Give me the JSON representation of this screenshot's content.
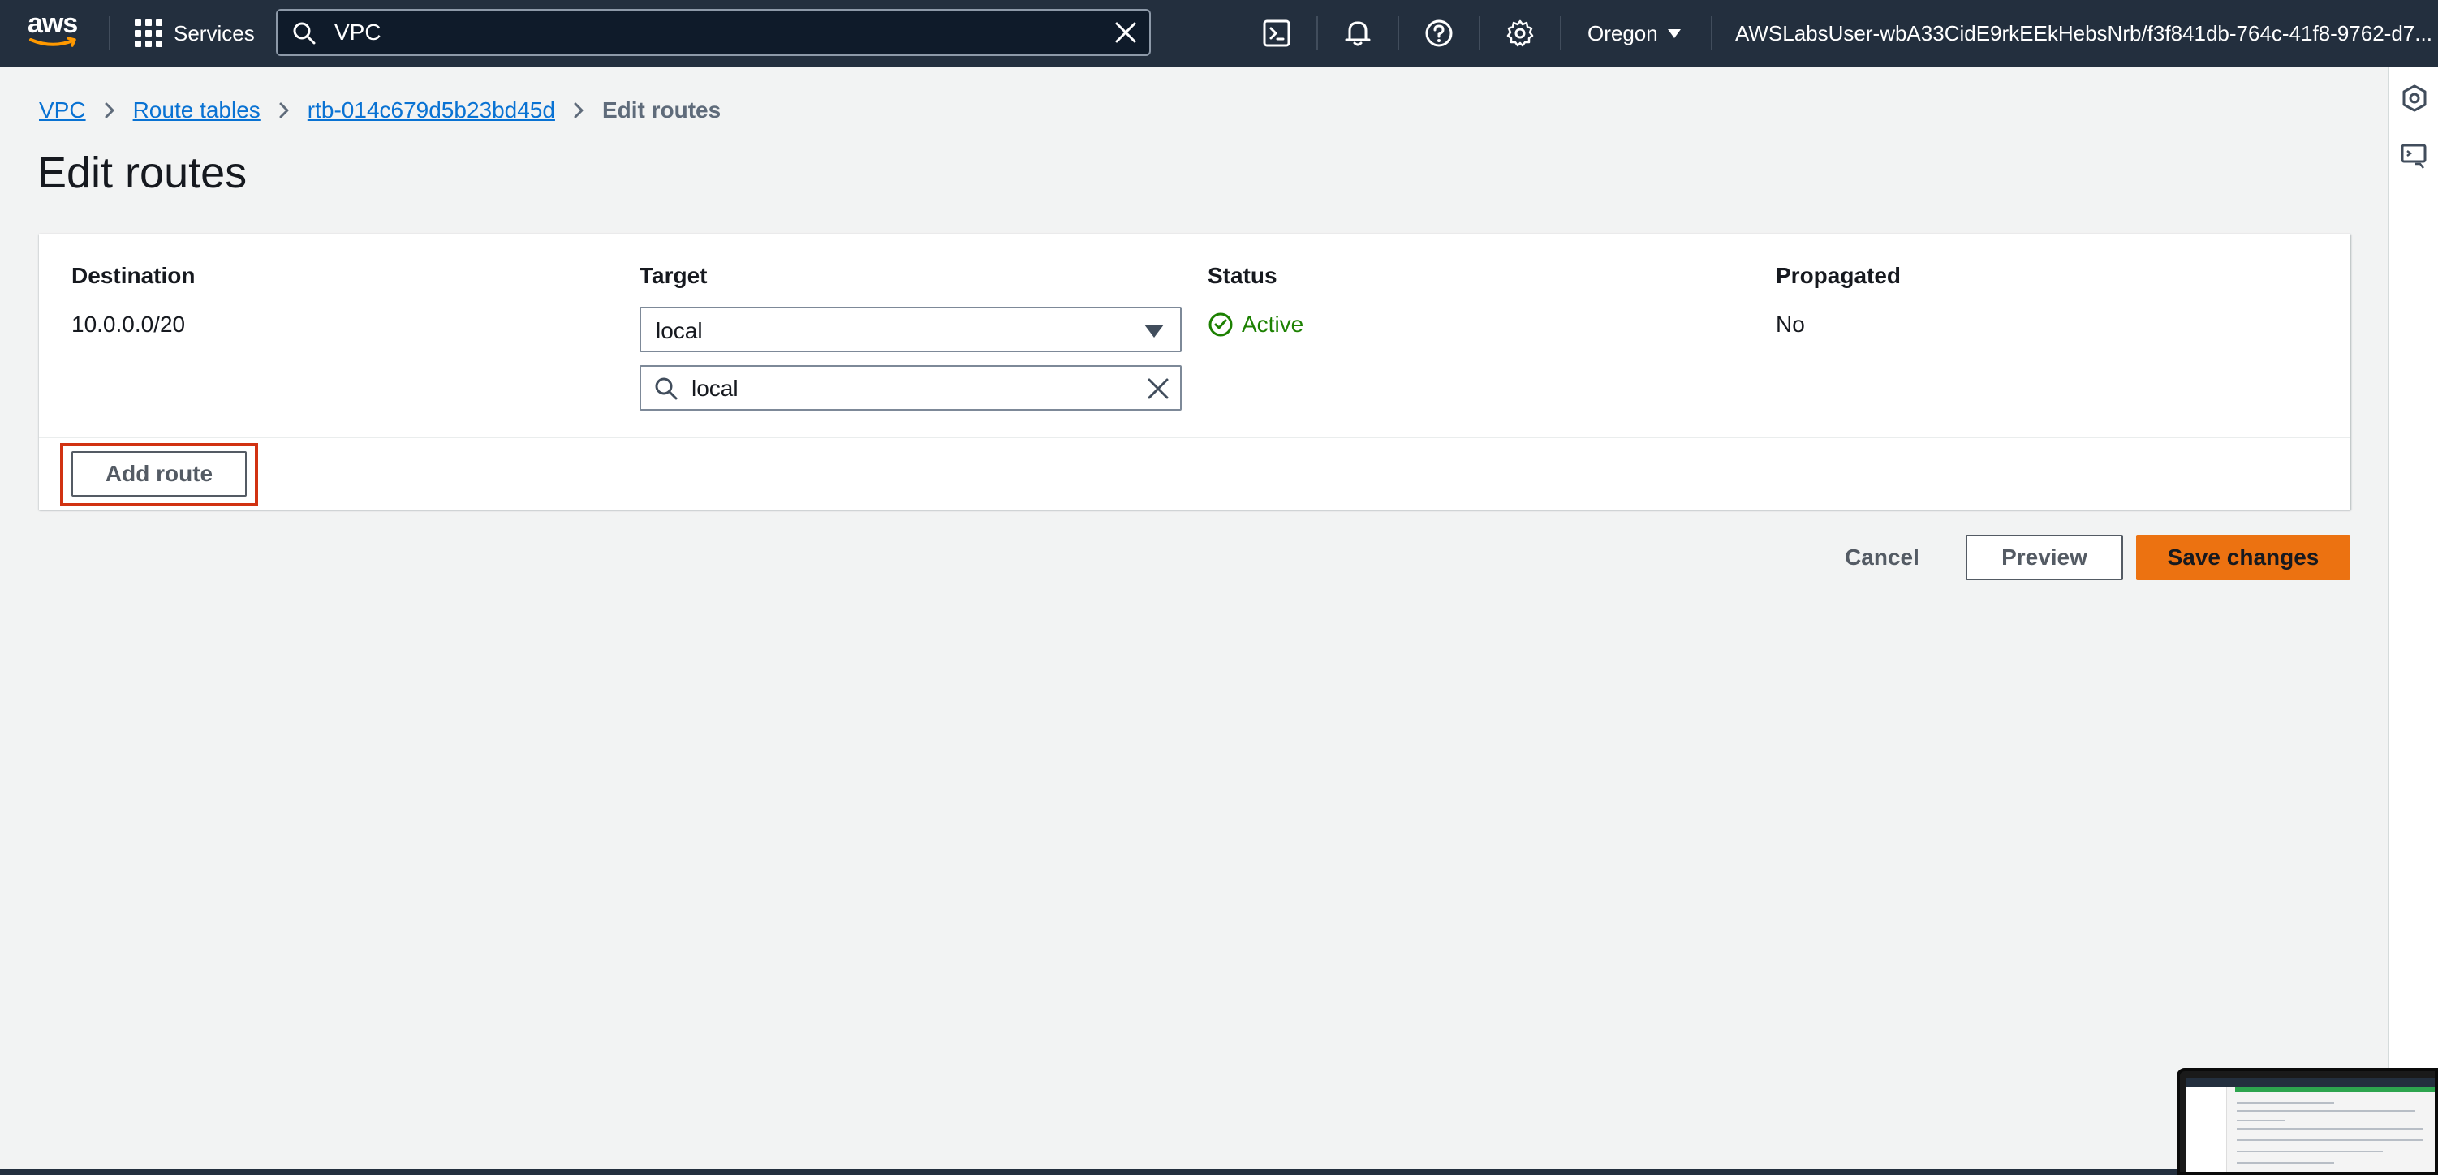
{
  "topnav": {
    "logo_text": "aws",
    "services_label": "Services",
    "search_value": "VPC",
    "region_label": "Oregon",
    "account_label": "AWSLabsUser-wbA33CidE9rkEEkHebsNrb/f3f841db-764c-41f8-9762-d7..."
  },
  "breadcrumb": {
    "items": [
      "VPC",
      "Route tables",
      "rtb-014c679d5b23bd45d"
    ],
    "current": "Edit routes"
  },
  "page": {
    "title": "Edit routes"
  },
  "routes_table": {
    "columns": [
      "Destination",
      "Target",
      "Status",
      "Propagated"
    ],
    "rows": [
      {
        "destination": "10.0.0.0/20",
        "target": "local",
        "target_filter": "local",
        "status": "Active",
        "propagated": "No"
      }
    ],
    "add_route_label": "Add route"
  },
  "actions": {
    "cancel_label": "Cancel",
    "preview_label": "Preview",
    "save_label": "Save changes"
  },
  "colors": {
    "nav_bg": "#232f3e",
    "link": "#0972d3",
    "status_active": "#1d8102",
    "primary_button": "#ec7211",
    "highlight": "#d13212"
  },
  "icons": {
    "services": "grid-icon",
    "search": "search-icon",
    "clear": "close-icon",
    "cloudshell": "terminal-icon",
    "notifications": "bell-icon",
    "help": "help-icon",
    "settings": "gear-icon",
    "status": "check-circle-icon"
  }
}
